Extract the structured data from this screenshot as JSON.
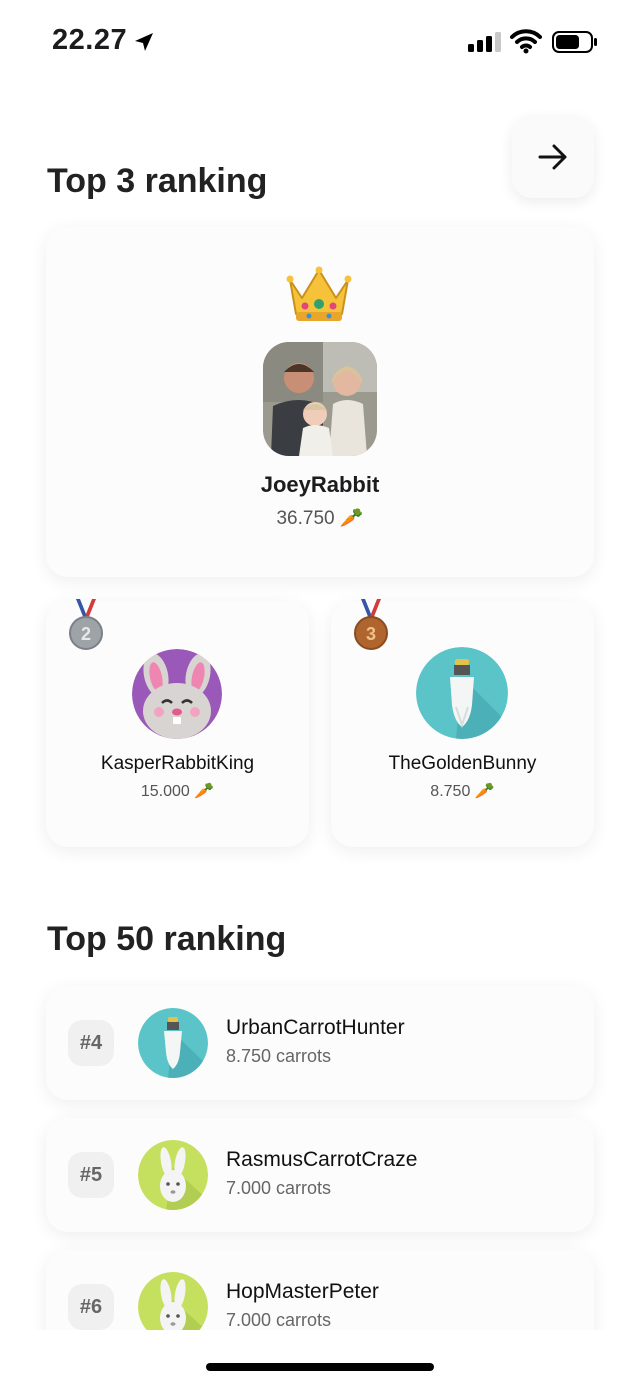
{
  "status_bar": {
    "time": "22.27"
  },
  "top3": {
    "title": "Top 3 ranking",
    "first": {
      "name": "JoeyRabbit",
      "score": "36.750 🥕"
    },
    "second": {
      "rank": "2",
      "name": "KasperRabbitKing",
      "score": "15.000 🥕"
    },
    "third": {
      "rank": "3",
      "name": "TheGoldenBunny",
      "score": "8.750 🥕"
    }
  },
  "top50": {
    "title": "Top 50 ranking",
    "rows": [
      {
        "rank": "#4",
        "name": "UrbanCarrotHunter",
        "carrots": "8.750 carrots"
      },
      {
        "rank": "#5",
        "name": "RasmusCarrotCraze",
        "carrots": "7.000 carrots"
      },
      {
        "rank": "#6",
        "name": "HopMasterPeter",
        "carrots": "7.000 carrots"
      }
    ]
  },
  "colors": {
    "teal_avatar": "#5bc4c9",
    "lime_avatar": "#c5df5f",
    "purple_avatar": "#9a58b8",
    "silver_medal": "#9ea3a8",
    "bronze_medal": "#b0652e"
  },
  "icons": [
    "location-arrow-icon",
    "signal-icon",
    "wifi-icon",
    "battery-icon",
    "arrow-right-icon",
    "crown-icon",
    "silver-medal-icon",
    "bronze-medal-icon",
    "carrot-icon"
  ]
}
